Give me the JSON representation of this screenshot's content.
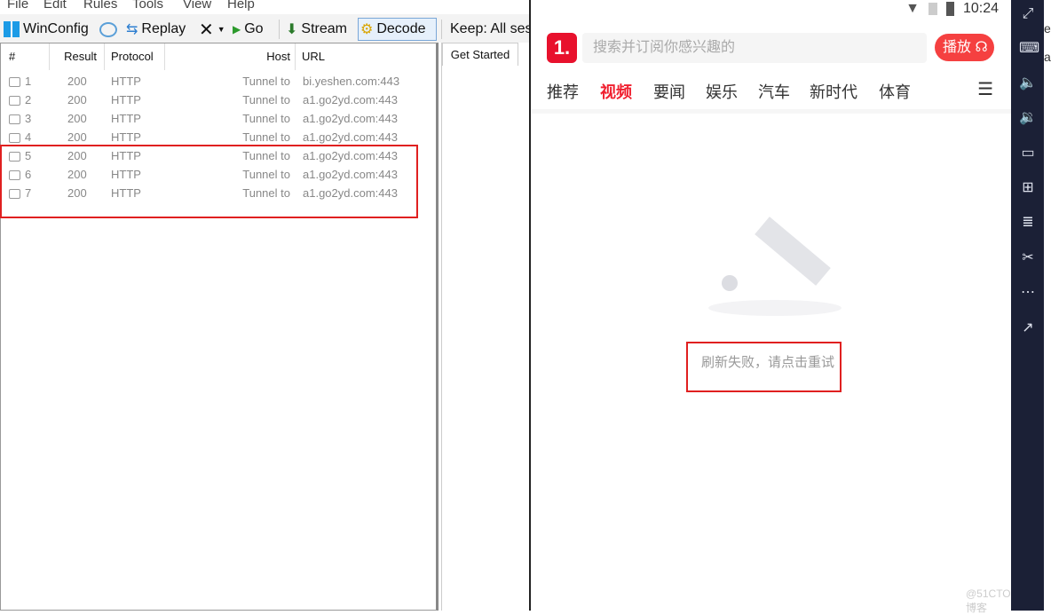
{
  "fiddler": {
    "menu": [
      "File",
      "Edit",
      "Rules",
      "Tools",
      "View",
      "Help"
    ],
    "toolbar": {
      "winconfig": "WinConfig",
      "replay": "Replay",
      "go": "Go",
      "stream": "Stream",
      "decode": "Decode",
      "keep": "Keep: All ses"
    },
    "columns": [
      "#",
      "Result",
      "Protocol",
      "Host",
      "URL"
    ],
    "rows": [
      {
        "id": "1",
        "result": "200",
        "protocol": "HTTP",
        "host": "Tunnel to",
        "url": "bi.yeshen.com:443"
      },
      {
        "id": "2",
        "result": "200",
        "protocol": "HTTP",
        "host": "Tunnel to",
        "url": "a1.go2yd.com:443"
      },
      {
        "id": "3",
        "result": "200",
        "protocol": "HTTP",
        "host": "Tunnel to",
        "url": "a1.go2yd.com:443"
      },
      {
        "id": "4",
        "result": "200",
        "protocol": "HTTP",
        "host": "Tunnel to",
        "url": "a1.go2yd.com:443"
      },
      {
        "id": "5",
        "result": "200",
        "protocol": "HTTP",
        "host": "Tunnel to",
        "url": "a1.go2yd.com:443"
      },
      {
        "id": "6",
        "result": "200",
        "protocol": "HTTP",
        "host": "Tunnel to",
        "url": "a1.go2yd.com:443"
      },
      {
        "id": "7",
        "result": "200",
        "protocol": "HTTP",
        "host": "Tunnel to",
        "url": "a1.go2yd.com:443"
      }
    ],
    "right_tab": "Get Started"
  },
  "phone": {
    "time": "10:24",
    "logo": "1.",
    "search_placeholder": "搜索并订阅你感兴趣的",
    "play_button": "播放",
    "tabs": [
      "推荐",
      "视频",
      "要闻",
      "娱乐",
      "汽车",
      "新时代",
      "体育"
    ],
    "active_tab": "视频",
    "error": "刷新失败，请点击重试",
    "accent": "#f0202f"
  },
  "edge_text": [
    "e",
    "a"
  ],
  "watermark": "@51CTO博客"
}
